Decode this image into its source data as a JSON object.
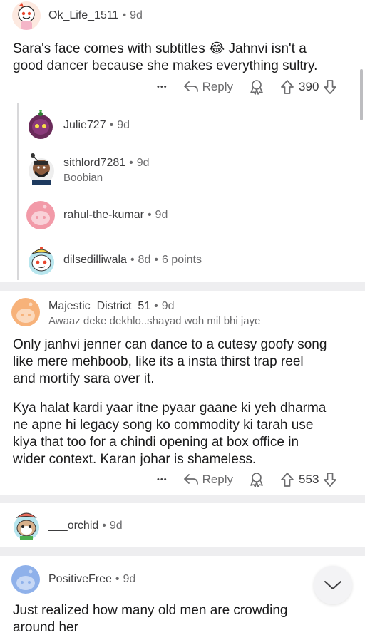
{
  "comments": [
    {
      "username": "Ok_Life_1511",
      "age": "9d",
      "body_lines": [
        "Sara's face comes with subtitles",
        "Jahnvi isn't a",
        "good dancer because she makes everything sultry."
      ],
      "emoji": "😂",
      "reply_label": "Reply",
      "votes": "390"
    },
    {
      "username": "Majestic_District_51",
      "age": "9d",
      "flair": "Awaaz deke dekhlo..shayad woh mil bhi jaye",
      "body_p1": [
        "Only janhvi jenner can dance to a cutesy goofy song",
        "like mere mehboob, like its a insta thirst trap reel",
        "and mortify sara over it."
      ],
      "body_p2": [
        "Kya halat kardi yaar itne pyaar gaane ki yeh dharma",
        "ne apne hi legacy song ko commodity ki tarah use",
        "kiya that too for a chindi opening at box office in",
        "wider context. Karan johar is shameless."
      ],
      "reply_label": "Reply",
      "votes": "553"
    },
    {
      "username": "___orchid",
      "age": "9d"
    },
    {
      "username": "PositiveFree",
      "age": "9d",
      "body_lines": [
        "Just realized how many old men are crowding",
        "around her"
      ]
    }
  ],
  "replies": [
    {
      "username": "Julie727",
      "age": "9d"
    },
    {
      "username": "sithlord7281",
      "age": "9d",
      "flair": "Boobian"
    },
    {
      "username": "rahul-the-kumar",
      "age": "9d"
    },
    {
      "username": "dilsedilliwala",
      "age": "8d",
      "points": "6 points"
    }
  ],
  "more_icon": "•••",
  "icons": [
    "reply-arrow-icon",
    "award-icon",
    "upvote-icon",
    "downvote-icon",
    "chevron-down-icon"
  ]
}
